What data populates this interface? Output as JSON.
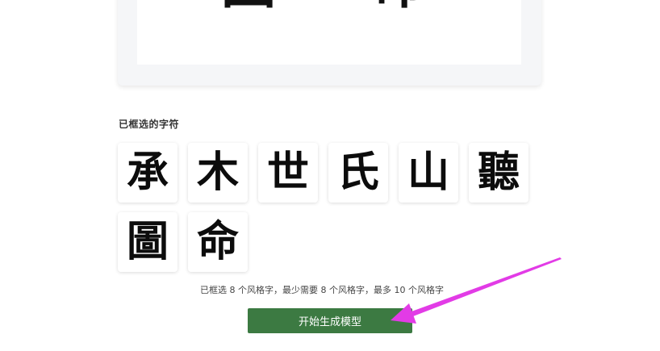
{
  "preview": {
    "glyphs": [
      "圖",
      "命"
    ]
  },
  "selected_section": {
    "title": "已框选的字符",
    "characters": [
      {
        "char": "承"
      },
      {
        "char": "木"
      },
      {
        "char": "世"
      },
      {
        "char": "氏"
      },
      {
        "char": "山"
      },
      {
        "char": "聽"
      },
      {
        "char": "圖"
      },
      {
        "char": "命"
      }
    ]
  },
  "status": {
    "text": "已框选 8 个风格字，最少需要 8 个风格字，最多 10 个风格字"
  },
  "actions": {
    "generate_label": "开始生成模型"
  },
  "annotation": {
    "arrow_color": "#e23be6"
  }
}
